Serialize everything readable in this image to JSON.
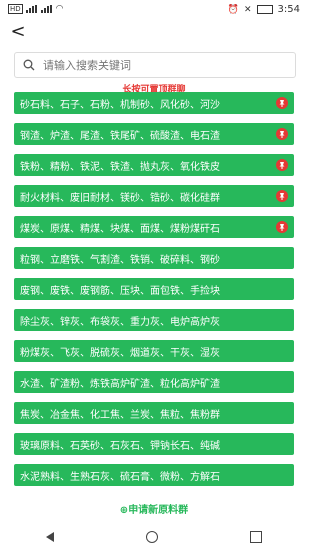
{
  "status": {
    "left_icons": [
      "hd-icon",
      "signal-icon",
      "signal-icon",
      "wifi-icon"
    ],
    "time": "3:54"
  },
  "search": {
    "placeholder": "请输入搜索关键词"
  },
  "hint": "长按可置顶群聊",
  "groups": [
    {
      "label": "砂石料、石子、石粉、机制砂、风化砂、河沙",
      "pinned": true
    },
    {
      "label": "钢渣、炉渣、尾渣、铁尾矿、硫酸渣、电石渣",
      "pinned": true
    },
    {
      "label": "铁粉、精粉、铁泥、铁渣、抛丸灰、氧化铁皮",
      "pinned": true
    },
    {
      "label": "耐火材料、废旧耐材、镁砂、锆砂、碳化硅群",
      "pinned": true
    },
    {
      "label": "煤炭、原煤、精煤、块煤、面煤、煤粉煤矸石",
      "pinned": true
    },
    {
      "label": "粒钢、立磨铁、气割渣、铁销、破碎料、钢砂",
      "pinned": false
    },
    {
      "label": "废钢、废铁、废钢筋、压块、面包铁、手捡块",
      "pinned": false
    },
    {
      "label": "除尘灰、锌灰、布袋灰、重力灰、电炉高炉灰",
      "pinned": false
    },
    {
      "label": "粉煤灰、飞灰、脱硫灰、烟道灰、干灰、湿灰",
      "pinned": false
    },
    {
      "label": "水渣、矿渣粉、炼铁高炉矿渣、粒化高炉矿渣",
      "pinned": false
    },
    {
      "label": "焦炭、冶金焦、化工焦、兰炭、焦粒、焦粉群",
      "pinned": false
    },
    {
      "label": "玻璃原料、石英砂、石灰石、钾钠长石、纯碱",
      "pinned": false
    },
    {
      "label": "水泥熟料、生熟石灰、硫石膏、微粉、方解石",
      "pinned": false
    }
  ],
  "apply": {
    "label": "申请新原料群"
  },
  "nav": [
    "back-nav-icon",
    "home-nav-icon",
    "recent-apps-icon"
  ]
}
